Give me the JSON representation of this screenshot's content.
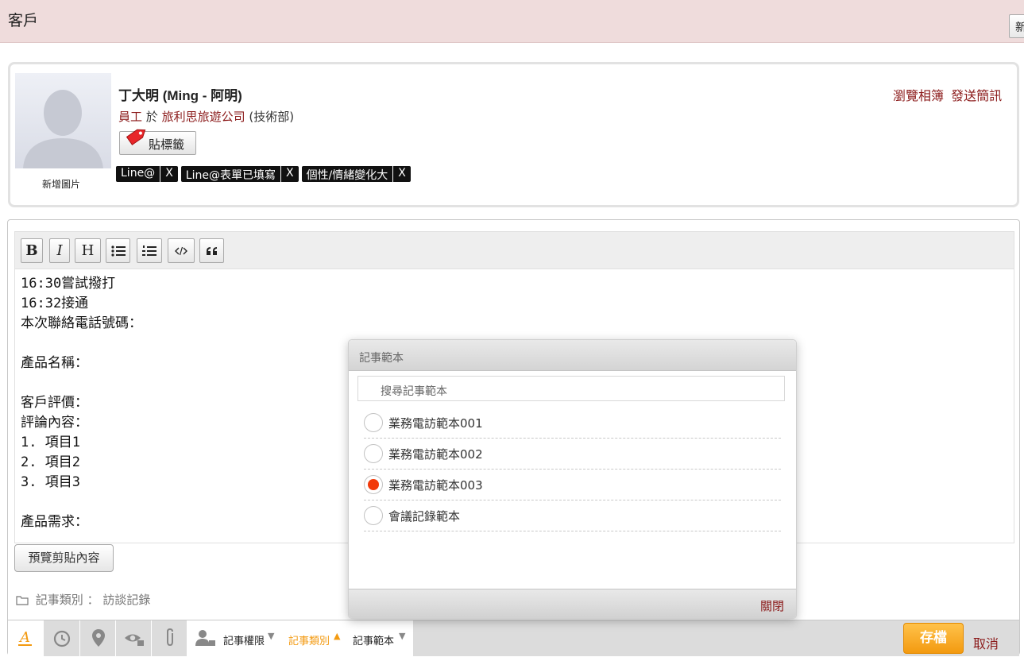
{
  "header": {
    "title": "客戶",
    "new_button": "新"
  },
  "profile": {
    "avatar_caption": "新增圖片",
    "name": "丁大明 (Ming - 阿明)",
    "role": "員工",
    "at": "於",
    "company": "旅利思旅遊公司",
    "department": "(技術部)",
    "tag_button": "貼標籤",
    "tags": [
      {
        "label": "Line@",
        "remove": "X"
      },
      {
        "label": "Line@表單已填寫",
        "remove": "X"
      },
      {
        "label": "個性/情緒變化大",
        "remove": "X"
      }
    ],
    "links": {
      "album": "瀏覽相簿",
      "sms": "發送簡訊"
    }
  },
  "editor": {
    "toolbar": {
      "bold": "B",
      "italic": "I",
      "heading": "H"
    },
    "content": "16:30嘗試撥打\n16:32接通\n本次聯絡電話號碼：\n\n產品名稱：\n\n客戶評價：\n評論內容：\n1. 項目1\n2. 項目2\n3. 項目3\n\n產品需求：",
    "preview_button": "預覽剪貼內容",
    "category_label": "記事類別",
    "category_sep": "：",
    "category_value": "訪談記錄"
  },
  "bottombar": {
    "permission": "記事權限",
    "category": "記事類別",
    "template": "記事範本",
    "save": "存檔",
    "cancel": "取消",
    "accent_color": "#f39a10"
  },
  "modal": {
    "title": "記事範本",
    "search_placeholder": "搜尋記事範本",
    "options": [
      {
        "label": "業務電訪範本001",
        "selected": false
      },
      {
        "label": "業務電訪範本002",
        "selected": false
      },
      {
        "label": "業務電訪範本003",
        "selected": true
      },
      {
        "label": "會議記錄範本",
        "selected": false
      }
    ],
    "close": "關閉",
    "selected_color": "#f23a0a"
  }
}
